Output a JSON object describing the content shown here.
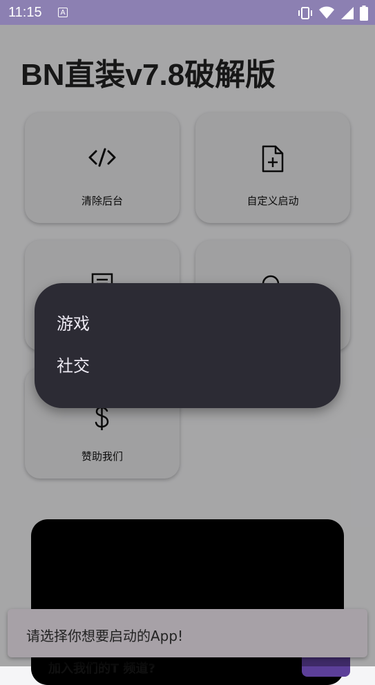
{
  "status_bar": {
    "time": "11:15",
    "badge": "A"
  },
  "app": {
    "title": "BN直装v7.8破解版"
  },
  "cards": [
    {
      "label": "清除后台",
      "icon": "code-icon"
    },
    {
      "label": "自定义启动",
      "icon": "file-plus-icon"
    },
    {
      "label": "",
      "icon": "document-icon"
    },
    {
      "label": "",
      "icon": "search-icon"
    },
    {
      "label": "赞助我们",
      "icon": "dollar-icon"
    }
  ],
  "popup": {
    "items": [
      "游戏",
      "社交"
    ]
  },
  "bottom": {
    "text": "加入我们的T          频道?"
  },
  "toast": {
    "text": "请选择你想要启动的App!"
  },
  "colors": {
    "status_bar": "#8c80b2",
    "popup_bg": "#2c2b34",
    "toast_bg": "#a7a1a7",
    "accent": "#5c3f99"
  }
}
